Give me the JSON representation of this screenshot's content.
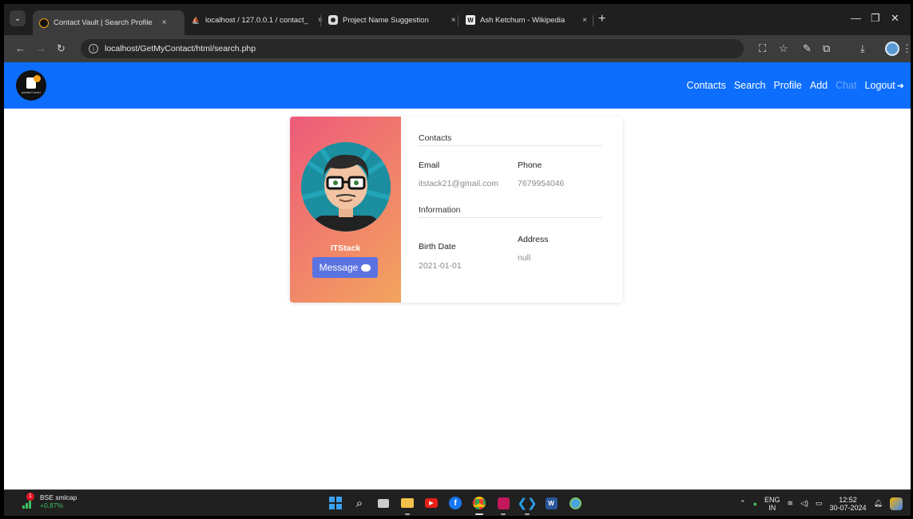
{
  "browser": {
    "tabs": [
      {
        "title": "Contact Vault | Search Profile",
        "active": true,
        "icon": "contact-vault-favicon"
      },
      {
        "title": "localhost / 127.0.0.1 / contact_",
        "active": false,
        "icon": "phpmyadmin-favicon"
      },
      {
        "title": "Project Name Suggestion",
        "active": false,
        "icon": "chatgpt-favicon"
      },
      {
        "title": "Ash Ketchum - Wikipedia",
        "active": false,
        "icon": "wikipedia-favicon"
      }
    ],
    "tab_close": "×",
    "new_tab": "+",
    "url": "localhost/GetMyContact/html/search.php"
  },
  "navbar": {
    "brand_logo_text": "CONTACT VAULT",
    "links": {
      "contacts": "Contacts",
      "search": "Search",
      "profile": "Profile",
      "add": "Add",
      "chat": "Chat",
      "logout": "Logout"
    }
  },
  "profile": {
    "name": "ITStack",
    "message_button": "Message",
    "contacts_heading": "Contacts",
    "email_label": "Email",
    "email_value": "itstack21@gmail.com",
    "phone_label": "Phone",
    "phone_value": "7679954046",
    "information_heading": "Information",
    "birth_label": "Birth Date",
    "birth_value": "2021-01-01",
    "address_label": "Address",
    "address_value": "null"
  },
  "taskbar": {
    "widget_badge": "1",
    "widget_title": "BSE smlcap",
    "widget_change": "+0.87%",
    "lang_top": "ENG",
    "lang_bottom": "IN",
    "time": "12:52",
    "date": "30-07-2024"
  },
  "colors": {
    "navbar": "#0d6efd",
    "card_gradient_start": "#ee5a7a",
    "card_gradient_end": "#f3a45e",
    "message_button": "#5b73e0"
  }
}
